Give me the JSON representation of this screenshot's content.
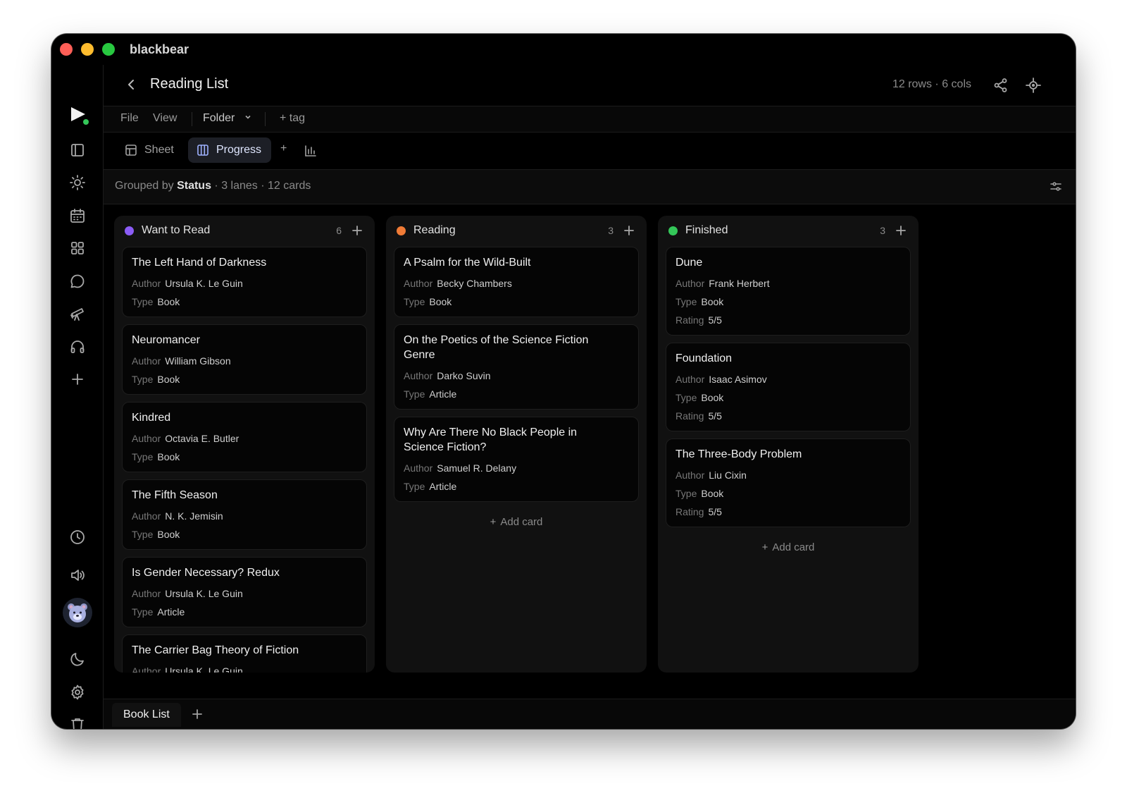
{
  "app": {
    "name": "blackbear"
  },
  "header": {
    "title": "Reading List",
    "dims": "12 rows · 6 cols"
  },
  "menu": {
    "file": "File",
    "view": "View",
    "folder": "Folder",
    "tag": "+ tag"
  },
  "views": {
    "sheet": "Sheet",
    "progress": "Progress",
    "add": "+"
  },
  "group": {
    "prefix": "Grouped by",
    "field": "Status",
    "summary": " · 3 lanes · 12 cards"
  },
  "colors": {
    "want": "#8b5cf6",
    "reading": "#f07b36",
    "finished": "#34c759"
  },
  "lanes": [
    {
      "title": "Want to Read",
      "count": "6",
      "cards": [
        {
          "title": "The Left Hand of Darkness",
          "author": "Ursula K. Le Guin",
          "type": "Book"
        },
        {
          "title": "Neuromancer",
          "author": "William Gibson",
          "type": "Book"
        },
        {
          "title": "Kindred",
          "author": "Octavia E. Butler",
          "type": "Book"
        },
        {
          "title": "The Fifth Season",
          "author": "N. K. Jemisin",
          "type": "Book"
        },
        {
          "title": "Is Gender Necessary? Redux",
          "author": "Ursula K. Le Guin",
          "type": "Article"
        },
        {
          "title": "The Carrier Bag Theory of Fiction",
          "author": "Ursula K. Le Guin"
        }
      ]
    },
    {
      "title": "Reading",
      "count": "3",
      "cards": [
        {
          "title": "A Psalm for the Wild-Built",
          "author": "Becky Chambers",
          "type": "Book"
        },
        {
          "title": "On the Poetics of the Science Fiction Genre",
          "author": "Darko Suvin",
          "type": "Article"
        },
        {
          "title": "Why Are There No Black People in Science Fiction?",
          "author": "Samuel R. Delany",
          "type": "Article"
        }
      ]
    },
    {
      "title": "Finished",
      "count": "3",
      "cards": [
        {
          "title": "Dune",
          "author": "Frank Herbert",
          "type": "Book",
          "rating": "5/5"
        },
        {
          "title": "Foundation",
          "author": "Isaac Asimov",
          "type": "Book",
          "rating": "5/5"
        },
        {
          "title": "The Three-Body Problem",
          "author": "Liu Cixin",
          "type": "Book",
          "rating": "5/5"
        }
      ]
    }
  ],
  "labels": {
    "author": "Author",
    "type": "Type",
    "rating": "Rating",
    "add_card": "Add card"
  },
  "bottom": {
    "sheet_tab": "Book List"
  }
}
